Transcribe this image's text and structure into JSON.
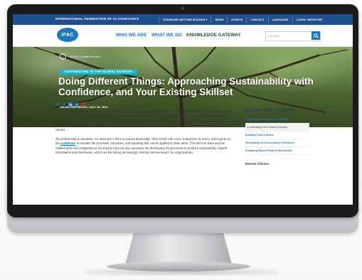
{
  "util_bar": {
    "org_name": "INTERNATIONAL FEDERATION OF ACCOUNTANTS",
    "links": [
      "STANDARD-SETTING BOARDS ▾",
      "NEWS",
      "EVENTS",
      "CONTACT",
      "LANGUAGE",
      "LOGIN / REGISTER"
    ]
  },
  "nav": {
    "logo_text": "IFAC",
    "items": [
      "WHO WE ARE",
      "WHAT WE DO",
      "KNOWLEDGE GATEWAY"
    ],
    "search_placeholder": "Keyword",
    "search_icon": "search-icon"
  },
  "hero": {
    "breadcrumb": "All IFAC Content Review",
    "tag": "CONTRIBUTING TO THE GLOBAL ECONOMY",
    "title": "Doing Different Things: Approaching Sustainability with Confidence, and Your Existing Skillset",
    "byline": "HELEN PARTRIDGE | JULY 30, 2021"
  },
  "share_icons": [
    "twitter-icon",
    "facebook-icon",
    "linkedin-icon",
    "mail-icon",
    "copy-link-icon"
  ],
  "article": {
    "paragraph1": "Professional accountant's historical role has been substantially founded in financial accounting and reporting. We have been asked to consider the financial ramifications of contracts and standards, prepare valuations and estimates to include in financial statements, develop controls to record monthly costs, produce and audit interim and annual financial statements and reports—to name a few. These are skills and competencies that we learn both in our initial training and development and as we continue to advance in our careers.",
    "paragraph2_pre": "As professional accountants, we also have a drive to pursue knowledge when faced with a new transaction or event, which gives us the ",
    "paragraph2_link": "confidence",
    "paragraph2_post": " to broaden the processes, structures, and reporting that can be applied to other areas. This drive to learn and the related skills and competencies we already have are also necessary for developing the processes to produce sustainability related information and disclosures, which are becoming increasingly relevant and necessary for organizations."
  },
  "sidebar": {
    "title": "Issues and Insights",
    "items": [
      "Supporting International Standards",
      "Contributing to the Global Economy",
      "Building Trust & Ethics",
      "Developing the Accountancy Profession",
      "Preparing Future-Ready Professionals"
    ],
    "active_index": 1,
    "recent_title": "Recent Articles"
  },
  "colors": {
    "brand_blue": "#1e4f8f",
    "link_blue": "#1a79c2",
    "tag_teal": "#23b1c7",
    "navy_text": "#1d3a5c"
  }
}
